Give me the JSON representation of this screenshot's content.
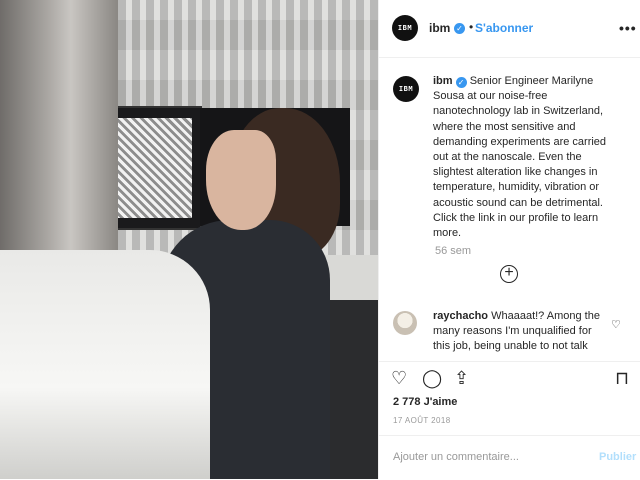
{
  "account": {
    "username": "ibm",
    "avatar_text": "IBM",
    "follow_label": "S'abonner",
    "separator": "•"
  },
  "caption": {
    "username": "ibm",
    "text": "Senior Engineer Marilyne Sousa at our noise-free nanotechnology lab in Switzerland, where the most sensitive and demanding experiments are carried out at the nanoscale. Even the slightest alteration like changes in temperature, humidity, vibration or acoustic sound can be detrimental. Click the link in our profile to learn more.",
    "time_ago": "56 sem"
  },
  "comments": [
    {
      "username": "raychacho",
      "text": "Whaaaat!? Among the many reasons I'm unqualified for this job, being unable to not talk"
    }
  ],
  "post": {
    "likes": "2 778 J'aime",
    "date": "17 AOÛT 2018"
  },
  "comment_box": {
    "placeholder": "Ajouter un commentaire...",
    "publish_label": "Publier"
  },
  "icons": {
    "more": "more-options-icon",
    "heart": "heart-icon",
    "comment": "comment-icon",
    "share": "share-icon",
    "save": "bookmark-icon",
    "load_more": "plus-circle-icon"
  },
  "colors": {
    "accent": "#3897f0",
    "publish_disabled": "#b2dffc",
    "muted": "#999999"
  }
}
